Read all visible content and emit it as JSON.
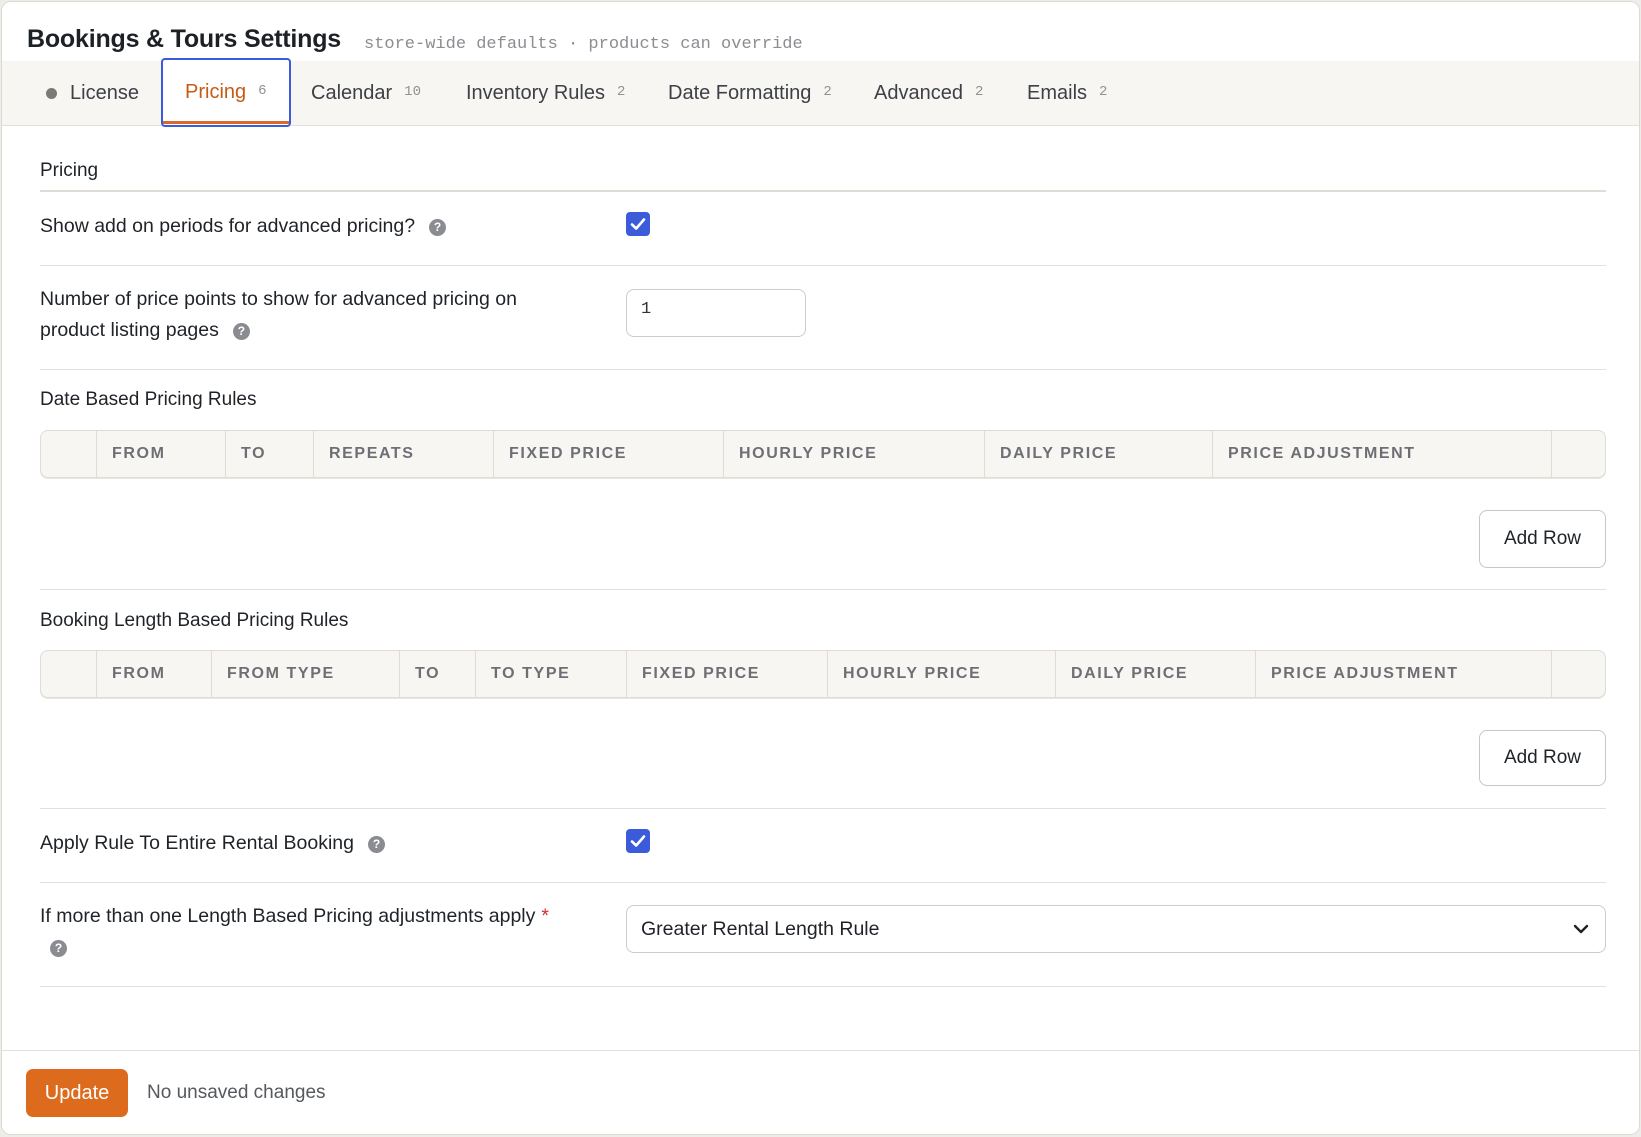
{
  "app": {
    "title": "Bookings & Tours Settings",
    "subtitle": "store-wide defaults · products can override"
  },
  "tabs": [
    {
      "label": "License",
      "count": ""
    },
    {
      "label": "Pricing",
      "count": "6"
    },
    {
      "label": "Calendar",
      "count": "10"
    },
    {
      "label": "Inventory Rules",
      "count": "2"
    },
    {
      "label": "Date Formatting",
      "count": "2"
    },
    {
      "label": "Advanced",
      "count": "2"
    },
    {
      "label": "Emails",
      "count": "2"
    }
  ],
  "pricing": {
    "section_title": "Pricing",
    "show_addon_label": "Show add on periods for advanced pricing?",
    "show_addon_checked": true,
    "price_points_label_line1": "Number of price points to show for advanced pricing on",
    "price_points_label_line2": "product listing pages",
    "price_points_value": "1",
    "date_rules_title": "Date Based Pricing Rules",
    "date_rules_columns": [
      "FROM",
      "TO",
      "REPEATS",
      "FIXED PRICE",
      "HOURLY PRICE",
      "DAILY PRICE",
      "PRICE ADJUSTMENT"
    ],
    "length_rules_title": "Booking Length Based Pricing Rules",
    "length_rules_columns": [
      "FROM",
      "FROM TYPE",
      "TO",
      "TO TYPE",
      "FIXED PRICE",
      "HOURLY PRICE",
      "DAILY PRICE",
      "PRICE ADJUSTMENT"
    ],
    "add_row_label": "Add Row",
    "apply_entire_label": "Apply Rule To Entire Rental Booking",
    "apply_entire_checked": true,
    "multi_rule_label": "If more than one Length Based Pricing adjustments apply",
    "required_mark": "*",
    "multi_rule_value": "Greater Rental Length Rule"
  },
  "footer": {
    "update_label": "Update",
    "status_text": "No unsaved changes"
  },
  "colors": {
    "accent": "#dd6b1d",
    "active_tab_text": "#c85a12",
    "focus_ring": "#3b5bdb",
    "checkbox": "#3b5bdb"
  }
}
